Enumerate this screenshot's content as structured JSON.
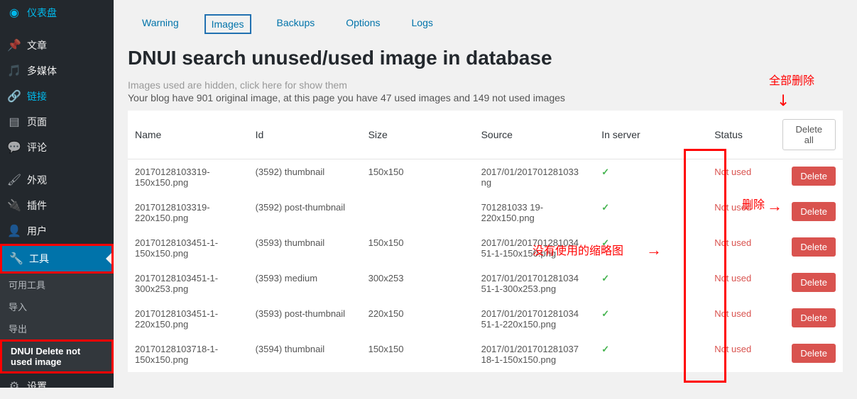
{
  "sidebar": {
    "items": [
      {
        "label": "仪表盘",
        "icon": "dashboard"
      },
      {
        "label": "文章",
        "icon": "pin"
      },
      {
        "label": "多媒体",
        "icon": "media"
      },
      {
        "label": "链接",
        "icon": "link"
      },
      {
        "label": "页面",
        "icon": "page"
      },
      {
        "label": "评论",
        "icon": "comment"
      },
      {
        "label": "外观",
        "icon": "brush"
      },
      {
        "label": "插件",
        "icon": "plug"
      },
      {
        "label": "用户",
        "icon": "user"
      },
      {
        "label": "工具",
        "icon": "wrench"
      },
      {
        "label": "设置",
        "icon": "settings"
      }
    ],
    "sub": {
      "available": "可用工具",
      "import": "导入",
      "export": "导出",
      "dnui": "DNUI Delete not used image"
    }
  },
  "tabs": {
    "warning": "Warning",
    "images": "Images",
    "backups": "Backups",
    "options": "Options",
    "logs": "Logs"
  },
  "page_title": "DNUI search unused/used image in database",
  "hint": "Images used are hidden, click here for show them",
  "stats": "Your blog have 901 original image, at this page you have 47 used images and 149 not used images",
  "table": {
    "headers": {
      "name": "Name",
      "id": "Id",
      "size": "Size",
      "source": "Source",
      "inserver": "In server",
      "status": "Status",
      "delete_all": "Delete all"
    },
    "rows": [
      {
        "name": "20170128103319-150x150.png",
        "id": "(3592) thumbnail",
        "size": "150x150",
        "source": "2017/01/201701281033 ng",
        "inserver": "✓",
        "status": "Not used",
        "action": "Delete"
      },
      {
        "name": "20170128103319-220x150.png",
        "id": "(3592) post-thumbnail",
        "size": "",
        "source": "701281033 19-220x150.png",
        "inserver": "✓",
        "status": "Not used",
        "action": "Delete"
      },
      {
        "name": "20170128103451-1-150x150.png",
        "id": "(3593) thumbnail",
        "size": "150x150",
        "source": "2017/01/201701281034 51-1-150x150.png",
        "inserver": "✓",
        "status": "Not used",
        "action": "Delete"
      },
      {
        "name": "20170128103451-1-300x253.png",
        "id": "(3593) medium",
        "size": "300x253",
        "source": "2017/01/201701281034 51-1-300x253.png",
        "inserver": "✓",
        "status": "Not used",
        "action": "Delete"
      },
      {
        "name": "20170128103451-1-220x150.png",
        "id": "(3593) post-thumbnail",
        "size": "220x150",
        "source": "2017/01/201701281034 51-1-220x150.png",
        "inserver": "✓",
        "status": "Not used",
        "action": "Delete"
      },
      {
        "name": "20170128103718-1-150x150.png",
        "id": "(3594) thumbnail",
        "size": "150x150",
        "source": "2017/01/201701281037 18-1-150x150.png",
        "inserver": "✓",
        "status": "Not used",
        "action": "Delete"
      }
    ]
  },
  "annotations": {
    "delete_all": "全部删除",
    "delete": "删除",
    "unused_thumb": "没有使用的缩略图"
  }
}
